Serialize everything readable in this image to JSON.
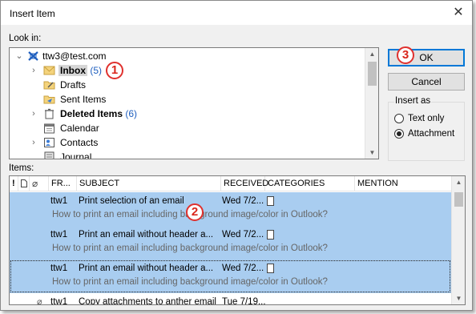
{
  "window": {
    "title": "Insert Item",
    "close_glyph": "✕"
  },
  "look_in": {
    "label": "Look in:",
    "tree": [
      {
        "label": "ttw3@test.com",
        "icon": "account-icon",
        "expanded": true
      },
      {
        "label": "Inbox",
        "count": "(5)",
        "icon": "inbox-folder-icon",
        "bold": true,
        "selected": true
      },
      {
        "label": "Drafts",
        "icon": "drafts-folder-icon"
      },
      {
        "label": "Sent Items",
        "icon": "sent-folder-icon"
      },
      {
        "label": "Deleted Items",
        "count": "(6)",
        "icon": "trash-icon",
        "bold": true
      },
      {
        "label": "Calendar",
        "icon": "calendar-icon"
      },
      {
        "label": "Contacts",
        "icon": "contacts-icon"
      },
      {
        "label": "Journal",
        "icon": "journal-icon"
      }
    ]
  },
  "buttons": {
    "ok": "OK",
    "cancel": "Cancel"
  },
  "insert_as": {
    "title": "Insert as",
    "options": [
      "Text only",
      "Attachment"
    ],
    "selected": "Attachment"
  },
  "items": {
    "label": "Items:",
    "columns": {
      "importance": "!",
      "icon": "",
      "attachment": "",
      "from": "FR...",
      "subject": "SUBJECT",
      "received": "RECEIVED",
      "categories": "CATEGORIES",
      "mention": "MENTION"
    },
    "rows": [
      {
        "from": "ttw1",
        "subject": "Print selection of an email",
        "received": "Wed 7/2...",
        "preview": "How to print an email including background image/color in Outlook?",
        "selected": true
      },
      {
        "from": "ttw1",
        "subject": "Print an email without header a...",
        "received": "Wed 7/2...",
        "preview": "How to print an email including background image/color in Outlook?",
        "selected": true
      },
      {
        "from": "ttw1",
        "subject": "Print an email without header a...",
        "received": "Wed 7/2...",
        "preview": "How to print an email including background image/color in Outlook?",
        "selected": true,
        "focused": true
      },
      {
        "from": "ttw1",
        "subject": "Copy attachments to anther email",
        "received": "Tue 7/19...",
        "has_attachment": true
      }
    ]
  },
  "annotations": [
    "1",
    "2",
    "3"
  ],
  "colors": {
    "selection": "#a9cdf0",
    "accent": "#0078d7",
    "badge": "#e0312e",
    "count": "#1f5fbf"
  }
}
